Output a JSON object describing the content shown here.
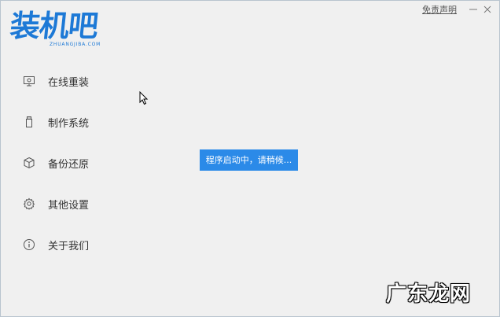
{
  "logo": {
    "main_text": "装机吧",
    "sub_text": "ZHUANGJIBA.COM"
  },
  "titlebar": {
    "disclaimer_label": "免责声明",
    "minimize_icon": "minimize-icon",
    "close_icon": "close-icon"
  },
  "menu": {
    "items": [
      {
        "label": "在线重装",
        "icon": "monitor-icon"
      },
      {
        "label": "制作系统",
        "icon": "usb-drive-icon"
      },
      {
        "label": "备份还原",
        "icon": "backup-cube-icon"
      },
      {
        "label": "其他设置",
        "icon": "gear-icon"
      },
      {
        "label": "关于我们",
        "icon": "info-icon"
      }
    ]
  },
  "status": {
    "loading_text": "程序启动中，请稍候..."
  },
  "watermark": {
    "text": "广东龙网"
  },
  "colors": {
    "brand_blue": "#1d79d6",
    "toast_blue": "#2b8ae8",
    "background": "#f0f0f0",
    "menu_text": "#333333"
  }
}
